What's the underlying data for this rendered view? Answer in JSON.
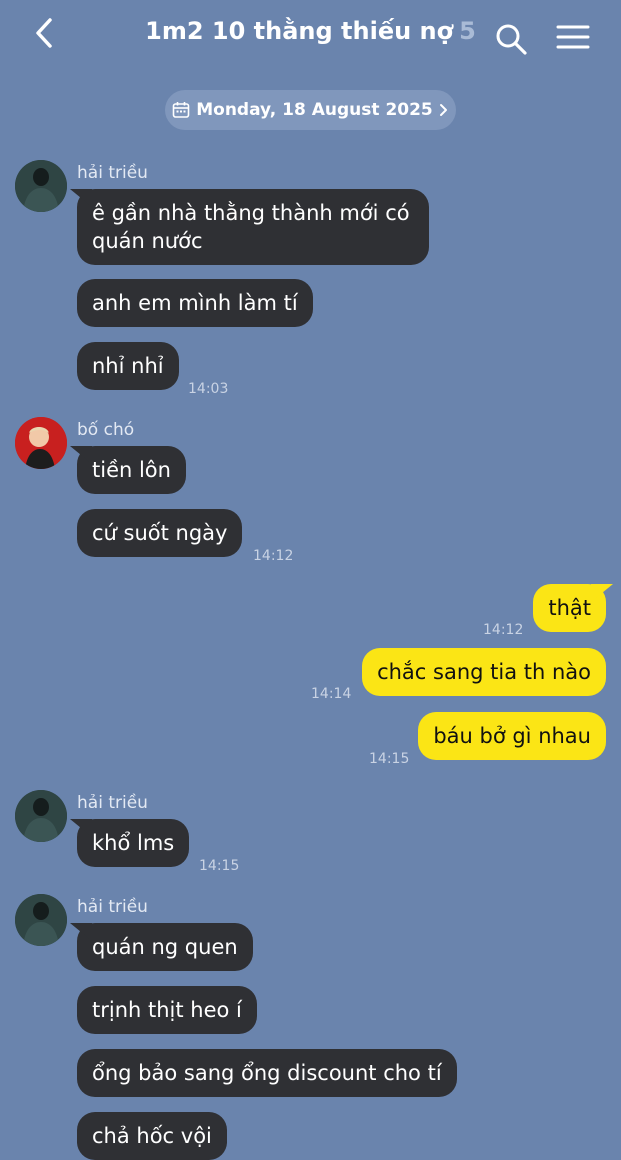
{
  "header": {
    "title": "1m2 10 thằng thiếu nợ",
    "member_count": "5",
    "icons": {
      "back": "chevron-left-icon",
      "search": "search-icon",
      "menu": "hamburger-menu-icon"
    }
  },
  "date_separator": {
    "label": "Monday, 18 August 2025"
  },
  "colors": {
    "background": "#6a84ad",
    "incoming_bubble": "#2f3034",
    "outgoing_bubble": "#fbe515"
  },
  "groups": [
    {
      "sender": "hải triều",
      "messages": [
        "ê gần nhà thằng thành mới có quán nước",
        "anh em mình làm tí",
        "nhỉ nhỉ"
      ],
      "time": "14:03"
    },
    {
      "sender": "bố chó",
      "messages": [
        "tiền lôn",
        "cứ suốt ngày"
      ],
      "time": "14:12"
    },
    {
      "outgoing": [
        {
          "text": "thật",
          "time": "14:12"
        },
        {
          "text": "chắc sang tia th nào",
          "time": "14:14"
        },
        {
          "text": "báu bở gì nhau",
          "time": "14:15"
        }
      ]
    },
    {
      "sender": "hải triều",
      "messages": [
        "khổ lms"
      ],
      "time": "14:15"
    },
    {
      "sender": "hải triều",
      "messages": [
        "quán ng quen",
        "trịnh thịt heo í",
        "ổng bảo sang ổng discount cho tí",
        "chả hốc vội"
      ]
    }
  ]
}
